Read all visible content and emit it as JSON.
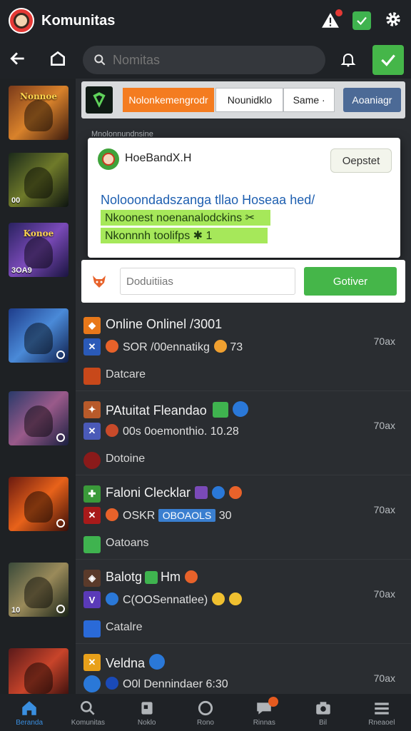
{
  "header": {
    "title": "Komunitas"
  },
  "search": {
    "placeholder": "Nomitas"
  },
  "colors": {
    "accent_green": "#45b649",
    "accent_orange": "#f47c20",
    "accent_blue": "#3a8fe0",
    "dark_bg": "#2a2d31"
  },
  "sidebar": {
    "thumbs": [
      {
        "title": "Nonnoe",
        "caption": "",
        "bg": "linear-gradient(135deg,#7a3a1a,#d9822b 50%,#3b1a0e)"
      },
      {
        "title": "",
        "caption": "00",
        "bg": "linear-gradient(135deg,#1b2a1a,#6f7a2a 50%,#0d1410)"
      },
      {
        "title": "Konoe",
        "caption": "3OA9",
        "bg": "linear-gradient(135deg,#2a2260,#7a4ab8 50%,#1a1440)"
      },
      {
        "title": "",
        "caption": "",
        "bg": "linear-gradient(135deg,#1e3c8a,#4a8ad8 50%,#0f1e4a)"
      },
      {
        "title": "",
        "caption": "",
        "bg": "linear-gradient(135deg,#2a3a6a,#9a5a8a 50%,#1a2040)"
      },
      {
        "title": "",
        "caption": "",
        "bg": "linear-gradient(135deg,#6a1a10,#e8621a 50%,#3a0e08)"
      },
      {
        "title": "",
        "caption": "10",
        "bg": "linear-gradient(135deg,#3a4a3a,#9a8a5a 50%,#1a2418)"
      },
      {
        "title": "",
        "caption": "",
        "bg": "linear-gradient(135deg,#5a1a1a,#c8442a 50%,#2a0a0a)"
      }
    ]
  },
  "filters": {
    "primary": "Nolonkemengrodr",
    "secondary1": "Nounidklo",
    "secondary2": "Same",
    "action": "Aoaniagr"
  },
  "subhead": "Mnolonnundnsine",
  "popup": {
    "name": "HoeBandX.H",
    "button": "Oepstet",
    "message": "Nolooondadszanga tllao Hoseaa hed/",
    "highlight1": "Nkoonest noenanalodckins ✂",
    "highlight2": "Nkonnnh toolifps ✱ 1"
  },
  "reply": {
    "placeholder": "Doduitiias",
    "send": "Gotiver"
  },
  "posts": [
    {
      "title": "Online Onlinel /3001",
      "meta": "SOR /00ennatikg",
      "meta2": "73",
      "sub": "Datcare",
      "count": "70ax"
    },
    {
      "title": "PAtuitat Fleandao",
      "meta": "00s 0oemonthio.",
      "meta2": "10.28",
      "sub": "Dotoine",
      "count": "70ax"
    },
    {
      "title": "Faloni Clecklar",
      "meta": "OSKR",
      "meta2": "30",
      "tag": "OBOAOLS",
      "sub": "Oatoans",
      "count": "70ax"
    },
    {
      "title": "Balotg",
      "title2": "Hm",
      "meta": "C(OOSennatlee)",
      "meta2": "",
      "sub": "Catalre",
      "count": "70ax"
    },
    {
      "title": "Veldna",
      "meta": "O0l Dennindaer",
      "meta2": "6:30",
      "sub": "",
      "count": "70ax"
    }
  ],
  "bottom_nav": [
    {
      "label": "Beranda",
      "icon": "home-icon",
      "active": true
    },
    {
      "label": "Komunitas",
      "icon": "search-icon",
      "active": false
    },
    {
      "label": "Noklo",
      "icon": "bookmark-icon",
      "active": false
    },
    {
      "label": "Rono",
      "icon": "circle-icon",
      "active": false
    },
    {
      "label": "Rinnas",
      "icon": "chat-icon",
      "active": false
    },
    {
      "label": "Bil",
      "icon": "camera-icon",
      "active": false
    },
    {
      "label": "Rneaoel",
      "icon": "menu-icon",
      "active": false
    }
  ]
}
